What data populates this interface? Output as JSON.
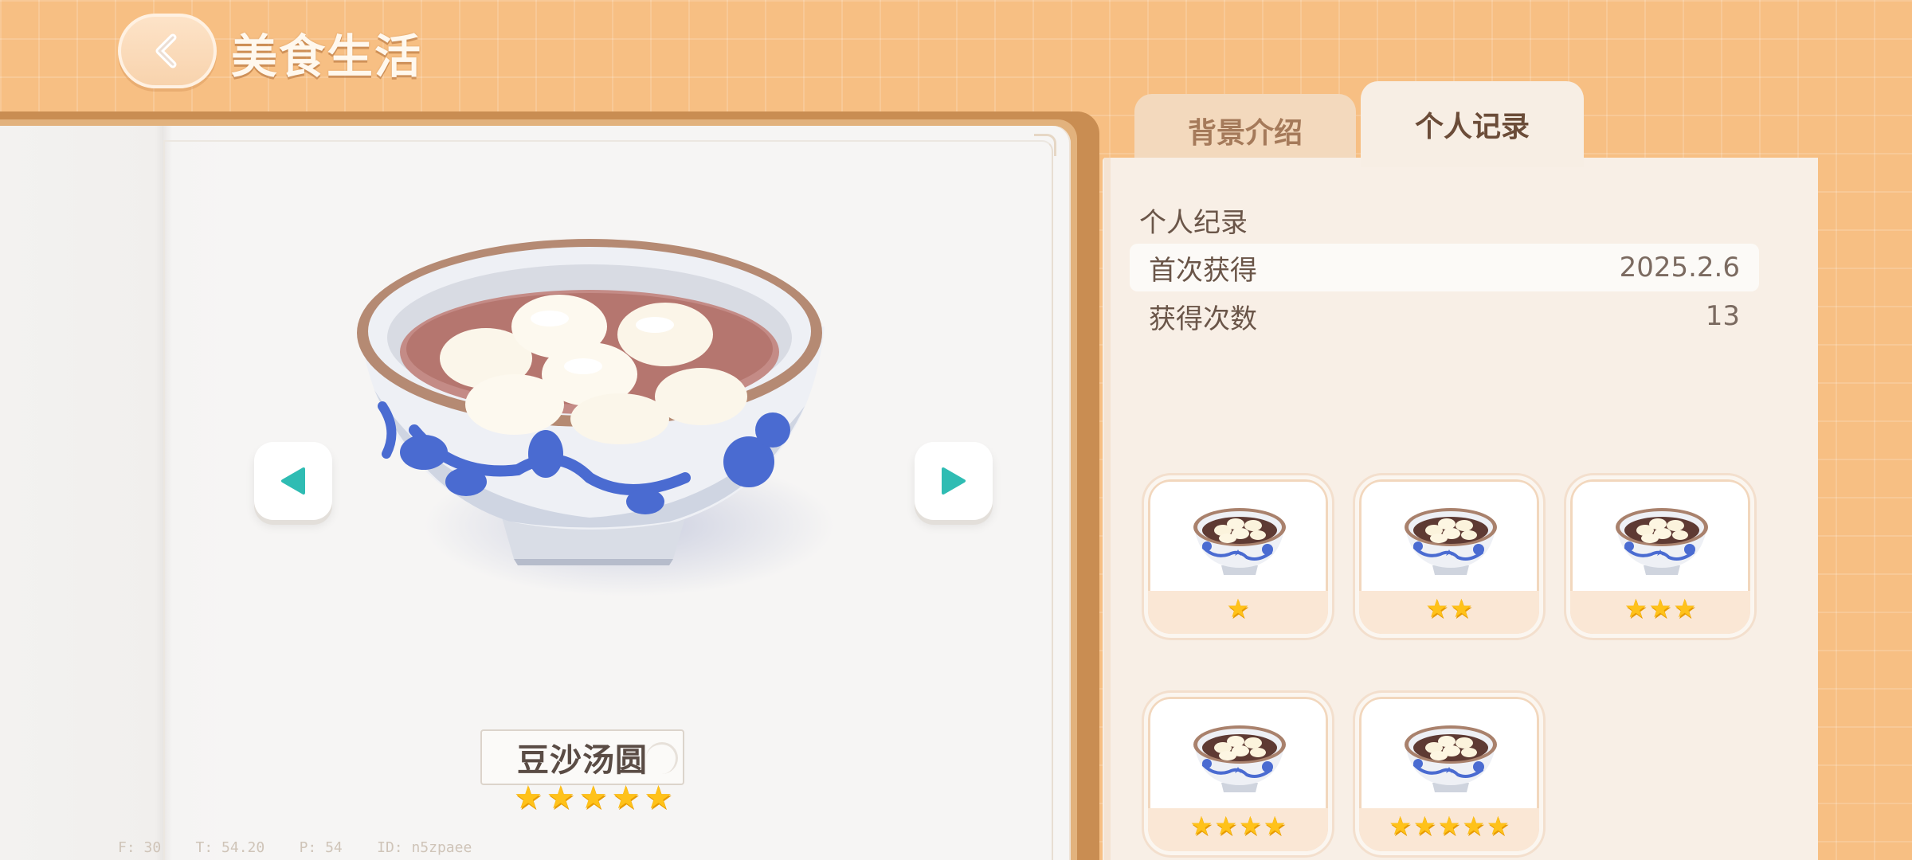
{
  "header": {
    "title": "美食生活"
  },
  "tabs": [
    {
      "label": "背景介绍",
      "active": false
    },
    {
      "label": "个人记录",
      "active": true
    }
  ],
  "record": {
    "section_title": "个人纪录",
    "rows": [
      {
        "label": "首次获得",
        "value": "2025.2.6"
      },
      {
        "label": "获得次数",
        "value": "13"
      }
    ]
  },
  "dish": {
    "name": "豆沙汤圆",
    "stars": 5
  },
  "variants": [
    {
      "stars": 1
    },
    {
      "stars": 2
    },
    {
      "stars": 3
    },
    {
      "stars": 4
    },
    {
      "stars": 5
    }
  ],
  "debug": "F: 30    T: 54.20    P: 54    ID: n5zpaee",
  "colors": {
    "accent": "#f7bf83",
    "star": "#ffc21a",
    "arrow": "#2fbcb3"
  },
  "icons": {
    "back": "chevron-left-icon",
    "prev": "triangle-left-icon",
    "next": "triangle-right-icon",
    "star": "star-icon"
  }
}
